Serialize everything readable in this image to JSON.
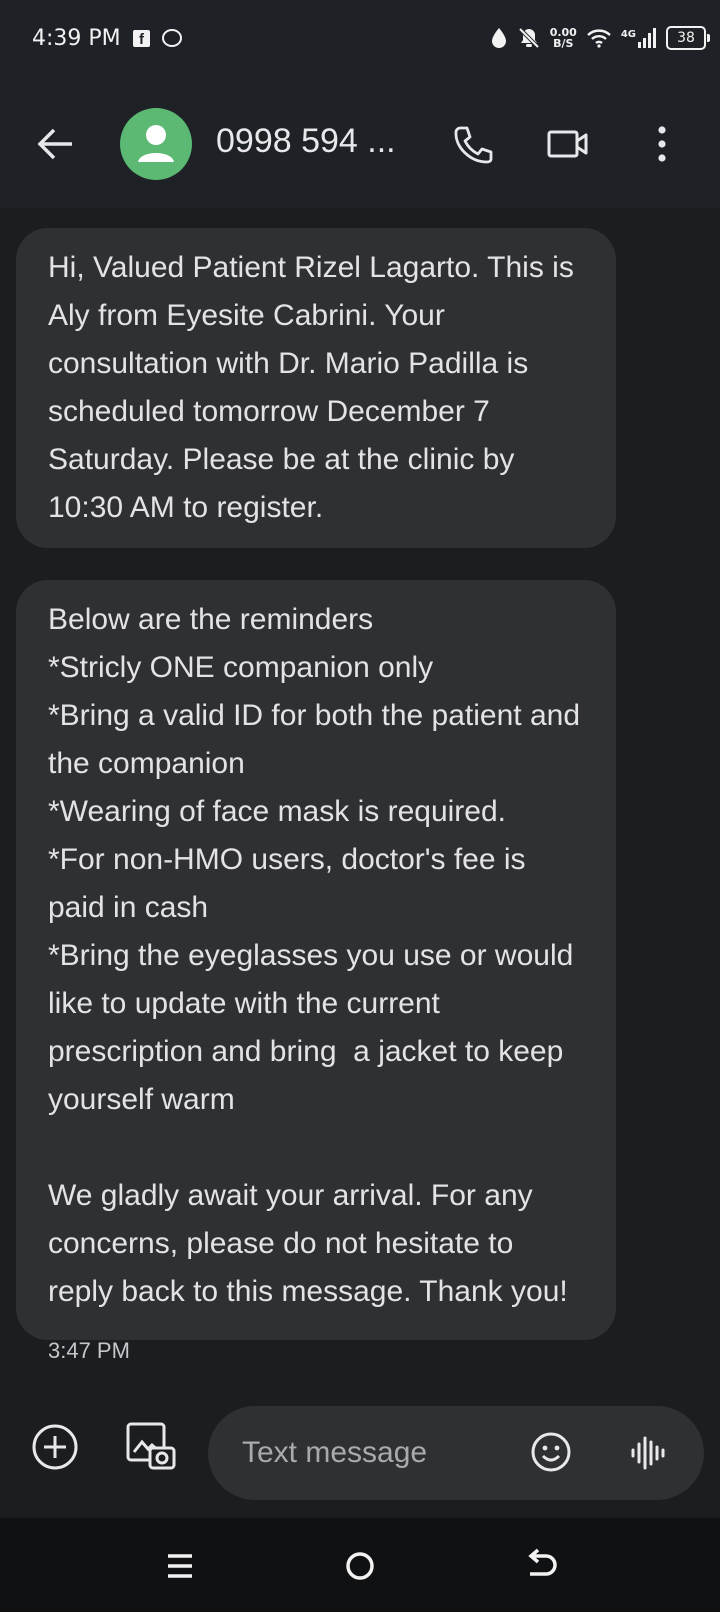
{
  "status_bar": {
    "time": "4:39 PM",
    "speed_value": "0.00",
    "speed_unit": "B/S",
    "network": "4G",
    "battery": "38",
    "icons": [
      "facebook-icon",
      "chat-head-icon",
      "data-saver-icon",
      "mute-icon",
      "wifi-icon",
      "signal-icon",
      "battery-icon"
    ]
  },
  "header": {
    "contact_name": "0998 594 ...",
    "icons": [
      "back-arrow-icon",
      "avatar-person-icon",
      "phone-icon",
      "video-call-icon",
      "more-vert-icon"
    ]
  },
  "messages": [
    {
      "text": "Hi, Valued Patient Rizel Lagarto. This is Aly from Eyesite Cabrini. Your consultation with Dr. Mario Padilla is scheduled tomorrow December 7 Saturday. Please be at the clinic by 10:30 AM to register."
    },
    {
      "text": "Below are the reminders\n*Stricly ONE companion only\n*Bring a valid ID for both the patient and the companion\n*Wearing of face mask is required.\n*For non-HMO users, doctor's fee is paid in cash\n*Bring the eyeglasses you use or would like to update with the current prescription and bring  a jacket to keep yourself warm\n\nWe gladly await your arrival. For any concerns, please do not hesitate to reply back to this message. Thank you!"
    }
  ],
  "timestamp": "3:47 PM",
  "compose": {
    "placeholder": "Text message",
    "icons": [
      "add-icon",
      "gallery-icon",
      "emoji-icon",
      "voice-icon"
    ]
  },
  "nav": {
    "icons": [
      "recents-icon",
      "home-icon",
      "back-icon"
    ]
  },
  "colors": {
    "background": "#1b1d21",
    "bubble": "#2f3033",
    "avatar": "#5bb974",
    "text": "#e3e3e5"
  }
}
